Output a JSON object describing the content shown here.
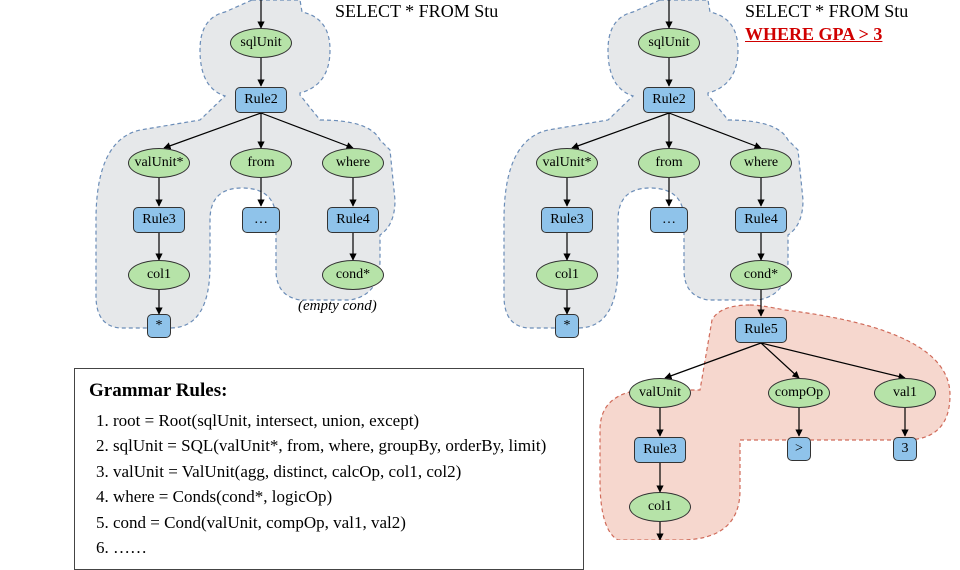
{
  "queries": {
    "left": {
      "line1": "SELECT * FROM Stu"
    },
    "right": {
      "line1": "SELECT * FROM Stu",
      "line2": "WHERE GPA > 3"
    }
  },
  "nodes": {
    "sqlUnit": "sqlUnit",
    "rule2": "Rule2",
    "valUnitStar": "valUnit*",
    "from": "from",
    "where": "where",
    "rule3": "Rule3",
    "dots": "…",
    "rule4": "Rule4",
    "col1": "col1",
    "condStar": "cond*",
    "star": "*",
    "rule5": "Rule5",
    "valUnit": "valUnit",
    "compOp": "compOp",
    "val1": "val1",
    "gt": ">",
    "three": "3"
  },
  "annotations": {
    "emptyCond": "(empty cond)"
  },
  "grammar": {
    "title": "Grammar Rules:",
    "r1": "root = Root(sqlUnit, intersect, union, except)",
    "r2": "sqlUnit = SQL(valUnit*, from, where, groupBy, orderBy, limit)",
    "r3": "valUnit = ValUnit(agg, distinct, calcOp, col1, col2)",
    "r4": "where = Conds(cond*, logicOp)",
    "r5": "cond = Cond(valUnit, compOp, val1, val2)",
    "r6": "……"
  }
}
